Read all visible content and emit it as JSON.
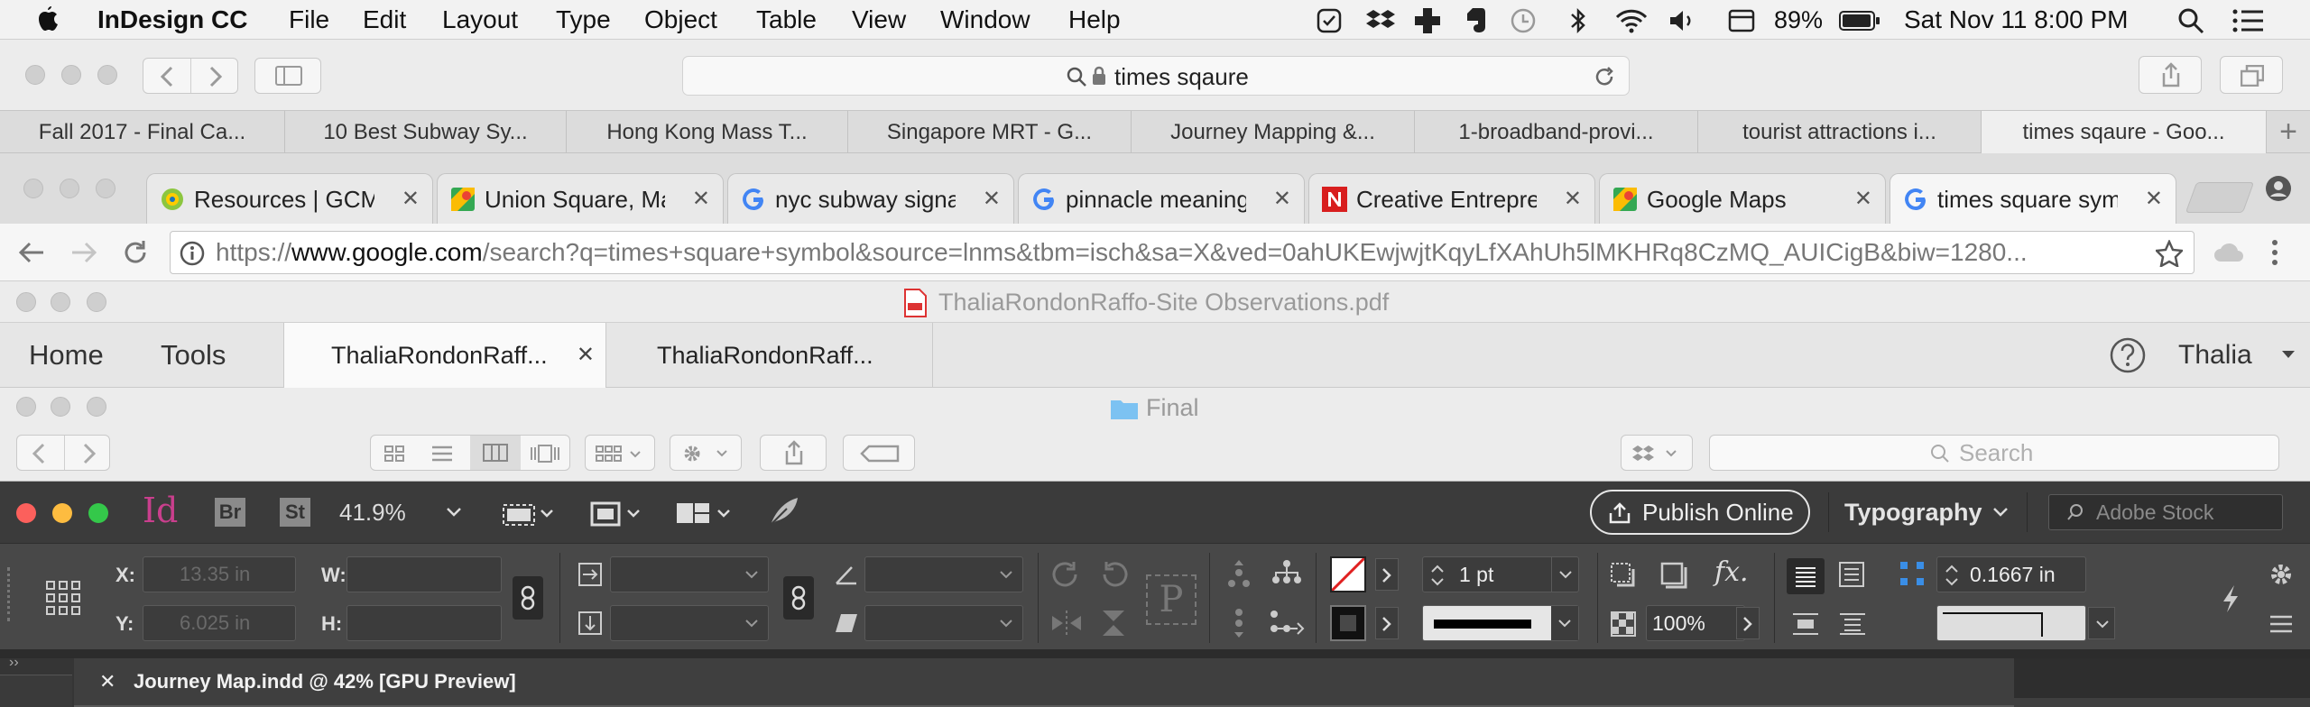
{
  "menubar": {
    "app_name": "InDesign CC",
    "menus": [
      "File",
      "Edit",
      "Layout",
      "Type",
      "Object",
      "Table",
      "View",
      "Window",
      "Help"
    ],
    "battery": "89%",
    "datetime": "Sat Nov 11  8:00 PM"
  },
  "safari": {
    "address": "times sqaure",
    "tabs": [
      "Fall 2017 - Final Ca...",
      "10 Best Subway Sy...",
      "Hong Kong Mass T...",
      "Singapore MRT - G...",
      "Journey Mapping &...",
      "1-broadband-provi...",
      "tourist attractions i...",
      "times sqaure - Goo..."
    ]
  },
  "chrome": {
    "tabs": [
      {
        "label": "Resources | GCMU",
        "favicon": "gcmu-favicon"
      },
      {
        "label": "Union Square, Man",
        "favicon": "google-maps-favicon"
      },
      {
        "label": "nyc subway signag",
        "favicon": "google-favicon"
      },
      {
        "label": "pinnacle meaning -",
        "favicon": "google-favicon"
      },
      {
        "label": "Creative Entrepren",
        "favicon": "n-favicon"
      },
      {
        "label": "Google Maps",
        "favicon": "google-maps-favicon"
      },
      {
        "label": "times square symb",
        "favicon": "google-favicon"
      }
    ],
    "url_prefix": "https://",
    "url_domain": "www.google.com",
    "url_rest": "/search?q=times+square+symbol&source=lnms&tbm=isch&sa=X&ved=0ahUKEwjwjtKqyLfXAhUh5lMKHRq8CzMQ_AUICigB&biw=1280..."
  },
  "pdf": {
    "title": "ThaliaRondonRaffo-Site Observations.pdf",
    "nav": [
      "Home",
      "Tools"
    ],
    "doc_tabs": [
      "ThaliaRondonRaff...",
      "ThaliaRondonRaff..."
    ],
    "user": "Thalia"
  },
  "finder": {
    "folder": "Final",
    "search_placeholder": "Search"
  },
  "indesign": {
    "app_icon": "Id",
    "bridge": "Br",
    "stock": "St",
    "zoom": "41.9%",
    "publish": "Publish Online",
    "workspace": "Typography",
    "stock_placeholder": "Adobe Stock",
    "x_label": "X:",
    "y_label": "Y:",
    "w_label": "W:",
    "h_label": "H:",
    "x_value": "13.35 in",
    "y_value": "6.025 in",
    "stroke_weight": "1 pt",
    "opacity": "100%",
    "spacing": "0.1667 in",
    "doc_tab": "Journey Map.indd @ 42% [GPU Preview]",
    "colors": {
      "accent_id": "#d4287f",
      "dark": "#3b3b3b"
    }
  }
}
